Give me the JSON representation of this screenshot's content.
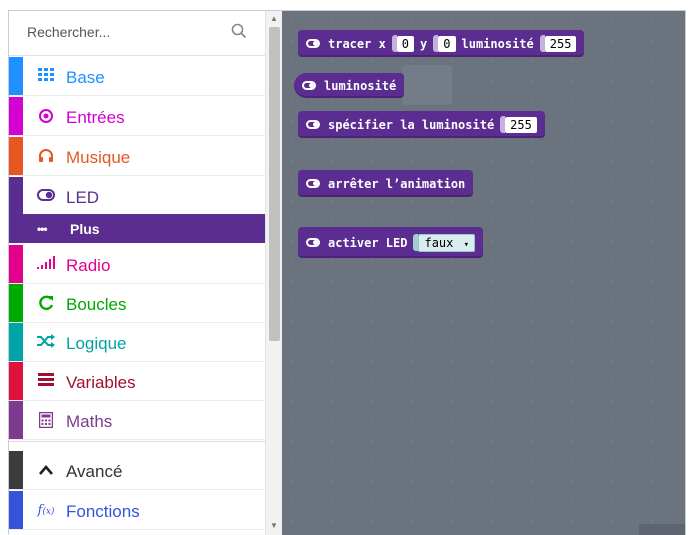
{
  "search": {
    "placeholder": "Rechercher..."
  },
  "categories": [
    {
      "label": "Base",
      "icon": "grid-icon",
      "color": "#1e90ff"
    },
    {
      "label": "Entrées",
      "icon": "radio-button-icon",
      "color": "#d400d4"
    },
    {
      "label": "Musique",
      "icon": "headphones-icon",
      "color": "#e65722"
    },
    {
      "label": "LED",
      "icon": "toggle-icon",
      "color": "#5c2d91"
    },
    {
      "label": "Plus",
      "icon": "more-icon",
      "color": "#5c2d91"
    },
    {
      "label": "Radio",
      "icon": "signal-icon",
      "color": "#e3008c"
    },
    {
      "label": "Boucles",
      "icon": "refresh-icon",
      "color": "#00aa00"
    },
    {
      "label": "Logique",
      "icon": "shuffle-icon",
      "color": "#00a4a6"
    },
    {
      "label": "Variables",
      "icon": "list-icon",
      "color": "#dc143c"
    },
    {
      "label": "Maths",
      "icon": "calculator-icon",
      "color": "#9400d3"
    },
    {
      "label": "Avancé",
      "icon": "chevron-up-icon",
      "color": "#3c3c3c"
    },
    {
      "label": "Fonctions",
      "icon": "function-icon",
      "color": "#3455db"
    }
  ],
  "blocks": {
    "plot": {
      "label": "tracer x",
      "x_value": "0",
      "y_label": "y",
      "y_value": "0",
      "brightness_label": "luminosité",
      "brightness_value": "255"
    },
    "brightness": {
      "label": "luminosité"
    },
    "set_brightness": {
      "label": "spécifier la luminosité",
      "value": "255"
    },
    "stop_animation": {
      "label": "arrêter l’animation"
    },
    "enable_led": {
      "label": "activer LED",
      "value": "faux",
      "dropdown_icon": "▾"
    }
  },
  "colors": {
    "led_block": "#5c2d91",
    "workspace": "#6b737f"
  }
}
